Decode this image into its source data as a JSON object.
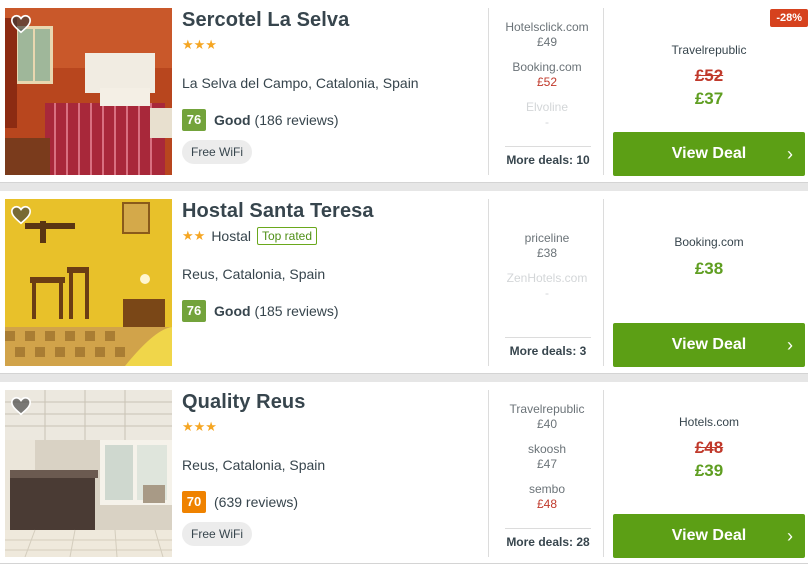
{
  "colors": {
    "accent_green": "#5c9f15",
    "price_red": "#c0392b",
    "score_green": "#73a33b",
    "score_orange": "#ef8200",
    "star": "#f5a623"
  },
  "hotels": [
    {
      "name": "Sercotel La Selva",
      "stars": "★★★",
      "star_count": 3,
      "type": "",
      "location": "La Selva del Campo, Catalonia, Spain",
      "score": "76",
      "rating_word": "Good",
      "reviews": "(186 reviews)",
      "amenity": "Free WiFi",
      "deals": [
        {
          "partner": "Hotelsclick.com",
          "price": "£49"
        },
        {
          "partner": "Booking.com",
          "price": "£52"
        },
        {
          "partner": "Elvoline",
          "price": "-"
        }
      ],
      "more_deals": "More deals: 10",
      "best_partner": "Travelrepublic",
      "old_price": "£52",
      "price": "£37",
      "discount": "-28%",
      "view_deal": "View Deal"
    },
    {
      "name": "Hostal Santa Teresa",
      "stars": "★★",
      "star_count": 2,
      "type": "Hostal",
      "badge": "Top rated",
      "location": "Reus, Catalonia, Spain",
      "score": "76",
      "rating_word": "Good",
      "reviews": "(185 reviews)",
      "deals": [
        {
          "partner": "priceline",
          "price": "£38"
        },
        {
          "partner": "ZenHotels.com",
          "price": "-"
        }
      ],
      "more_deals": "More deals: 3",
      "best_partner": "Booking.com",
      "price": "£38",
      "view_deal": "View Deal"
    },
    {
      "name": "Quality Reus",
      "stars": "★★★",
      "star_count": 3,
      "location": "Reus, Catalonia, Spain",
      "score": "70",
      "reviews": "(639 reviews)",
      "amenity": "Free WiFi",
      "deals": [
        {
          "partner": "Travelrepublic",
          "price": "£40"
        },
        {
          "partner": "skoosh",
          "price": "£47"
        },
        {
          "partner": "sembo",
          "price": "£48"
        }
      ],
      "more_deals": "More deals: 28",
      "best_partner": "Hotels.com",
      "old_price": "£48",
      "price": "£39",
      "view_deal": "View Deal"
    }
  ],
  "icons": {
    "favorite": "heart-icon",
    "chevron": "chevron-right-icon"
  }
}
